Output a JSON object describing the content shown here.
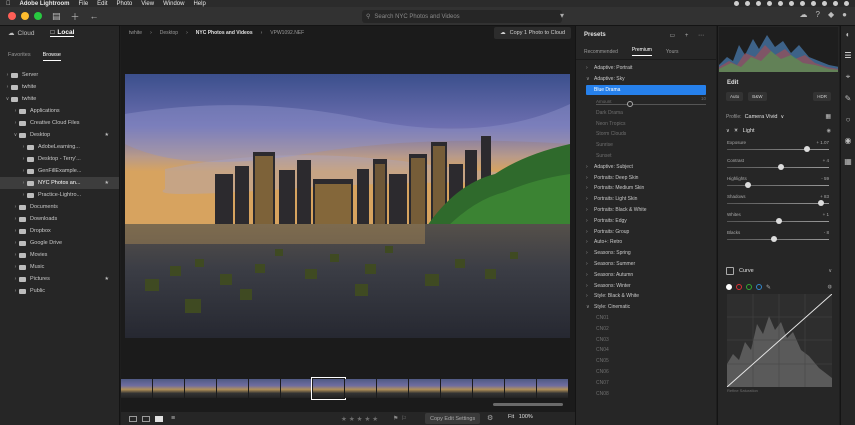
{
  "menubar": {
    "app_name": "Adobe Lightroom",
    "items": [
      "File",
      "Edit",
      "Photo",
      "View",
      "Window",
      "Help"
    ]
  },
  "topbar": {
    "search_placeholder": "Search NYC Photos and Videos"
  },
  "sources": {
    "tabs": [
      "Cloud",
      "Local"
    ],
    "active_tab": "Local",
    "subtabs": [
      "Favorites",
      "Browse"
    ],
    "active_subtab": "Browse",
    "tree": [
      {
        "label": "Server",
        "depth": 0,
        "expanded": false,
        "star": false
      },
      {
        "label": "twhite",
        "depth": 0,
        "expanded": false,
        "star": false
      },
      {
        "label": "twhite",
        "depth": 0,
        "expanded": true,
        "star": false
      },
      {
        "label": "Applications",
        "depth": 1,
        "expanded": false,
        "star": false
      },
      {
        "label": "Creative Cloud Files",
        "depth": 1,
        "expanded": false,
        "star": false
      },
      {
        "label": "Desktop",
        "depth": 1,
        "expanded": true,
        "star": true
      },
      {
        "label": "AdobeLearning...",
        "depth": 2,
        "expanded": false,
        "star": false
      },
      {
        "label": "Desktop - Terry'...",
        "depth": 2,
        "expanded": false,
        "star": false
      },
      {
        "label": "GenFillExample...",
        "depth": 2,
        "expanded": false,
        "star": false
      },
      {
        "label": "NYC Photos an...",
        "depth": 2,
        "expanded": false,
        "star": true,
        "selected": true
      },
      {
        "label": "Practice-Lightro...",
        "depth": 2,
        "expanded": false,
        "star": false
      },
      {
        "label": "Documents",
        "depth": 1,
        "expanded": false,
        "star": false
      },
      {
        "label": "Downloads",
        "depth": 1,
        "expanded": false,
        "star": false
      },
      {
        "label": "Dropbox",
        "depth": 1,
        "expanded": false,
        "star": false
      },
      {
        "label": "Google Drive",
        "depth": 1,
        "expanded": false,
        "star": false
      },
      {
        "label": "Movies",
        "depth": 1,
        "expanded": false,
        "star": false
      },
      {
        "label": "Music",
        "depth": 1,
        "expanded": false,
        "star": false
      },
      {
        "label": "Pictures",
        "depth": 1,
        "expanded": false,
        "star": true
      },
      {
        "label": "Public",
        "depth": 1,
        "expanded": false,
        "star": false
      }
    ]
  },
  "breadcrumb": [
    "twhite",
    "Desktop",
    "NYC Photos and Videos",
    "VPW1092.NEF"
  ],
  "copy_to_cloud": "Copy 1 Photo to Cloud",
  "filmstrip": {
    "count": 14,
    "selected_index": 6
  },
  "bottombar": {
    "copy_edit_settings": "Copy Edit Settings",
    "fit_label": "Fit",
    "zoom": "100%"
  },
  "presets": {
    "title": "Presets",
    "tabs": [
      "Recommended",
      "Premium",
      "Yours"
    ],
    "active_tab": "Premium",
    "amount_label": "Amount",
    "amount_value": "10",
    "rows": [
      {
        "label": "Adaptive: Portrait",
        "type": "group",
        "expanded": false
      },
      {
        "label": "Adaptive: Sky",
        "type": "group",
        "expanded": true
      },
      {
        "label": "Blue Drama",
        "type": "selected"
      },
      {
        "label": "__amount__",
        "type": "amount"
      },
      {
        "label": "Dark Drama",
        "type": "sub"
      },
      {
        "label": "Neon Tropics",
        "type": "sub"
      },
      {
        "label": "Storm Clouds",
        "type": "sub"
      },
      {
        "label": "Sunrise",
        "type": "sub"
      },
      {
        "label": "Sunset",
        "type": "sub"
      },
      {
        "label": "Adaptive: Subject",
        "type": "group",
        "expanded": false
      },
      {
        "label": "Portraits: Deep Skin",
        "type": "group",
        "expanded": false
      },
      {
        "label": "Portraits: Medium Skin",
        "type": "group",
        "expanded": false
      },
      {
        "label": "Portraits: Light Skin",
        "type": "group",
        "expanded": false
      },
      {
        "label": "Portraits: Black & White",
        "type": "group",
        "expanded": false
      },
      {
        "label": "Portraits: Edgy",
        "type": "group",
        "expanded": false
      },
      {
        "label": "Portraits: Group",
        "type": "group",
        "expanded": false
      },
      {
        "label": "Auto+: Retro",
        "type": "group",
        "expanded": false
      },
      {
        "label": "Seasons: Spring",
        "type": "group",
        "expanded": false
      },
      {
        "label": "Seasons: Summer",
        "type": "group",
        "expanded": false
      },
      {
        "label": "Seasons: Autumn",
        "type": "group",
        "expanded": false
      },
      {
        "label": "Seasons: Winter",
        "type": "group",
        "expanded": false
      },
      {
        "label": "Style: Black & White",
        "type": "group",
        "expanded": false
      },
      {
        "label": "Style: Cinematic",
        "type": "group",
        "expanded": true
      },
      {
        "label": "CN01",
        "type": "sub"
      },
      {
        "label": "CN02",
        "type": "sub"
      },
      {
        "label": "CN03",
        "type": "sub"
      },
      {
        "label": "CN04",
        "type": "sub"
      },
      {
        "label": "CN05",
        "type": "sub"
      },
      {
        "label": "CN06",
        "type": "sub"
      },
      {
        "label": "CN07",
        "type": "sub"
      },
      {
        "label": "CN08",
        "type": "sub"
      }
    ]
  },
  "edit": {
    "title": "Edit",
    "buttons": [
      "Auto",
      "B&W",
      "HDR"
    ],
    "profile_label": "Profile:",
    "profile_value": "Camera Vivid",
    "light_title": "Light",
    "sliders": [
      {
        "label": "Exposure",
        "value": "+ 1.07",
        "position": 0.78
      },
      {
        "label": "Contrast",
        "value": "+ 4",
        "position": 0.52
      },
      {
        "label": "Highlights",
        "value": "- 59",
        "position": 0.2
      },
      {
        "label": "Shadows",
        "value": "+ 83",
        "position": 0.91
      },
      {
        "label": "Whites",
        "value": "+ 1",
        "position": 0.5
      },
      {
        "label": "Blacks",
        "value": "- 8",
        "position": 0.46
      }
    ],
    "curve_title": "Curve",
    "curve_footer": "Refine Saturation"
  }
}
